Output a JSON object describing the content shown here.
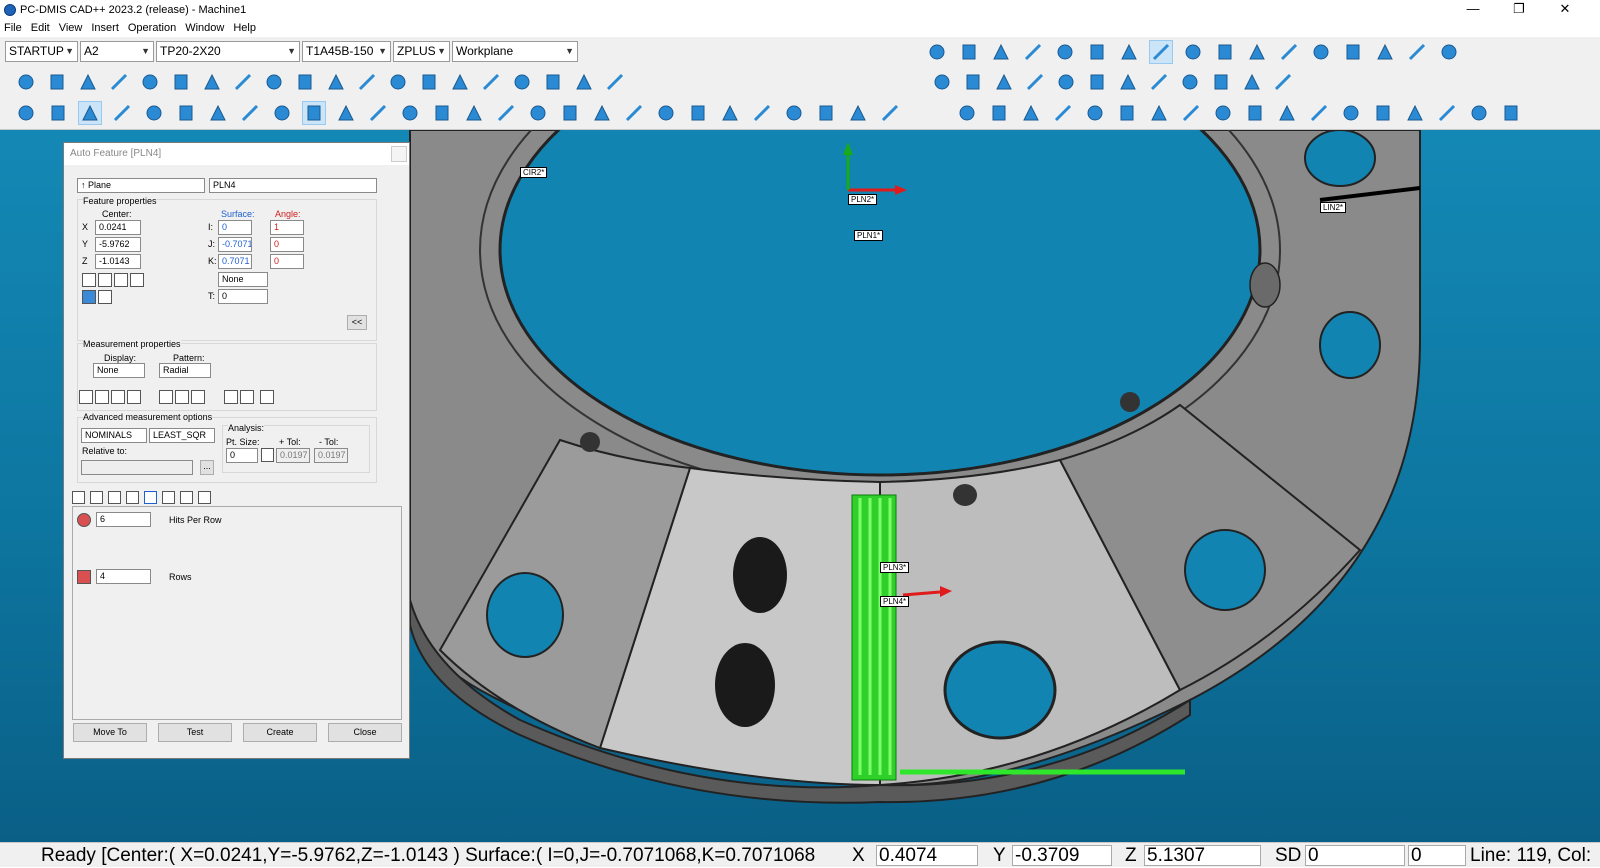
{
  "window": {
    "title": "PC-DMIS CAD++ 2023.2 (release) - Machine1",
    "minimize_glyph": "—",
    "restore_glyph": "❐",
    "close_glyph": "✕"
  },
  "menu": [
    "File",
    "Edit",
    "View",
    "Insert",
    "Operation",
    "Window",
    "Help"
  ],
  "toolbar": {
    "combos": [
      {
        "name": "alignment-combo",
        "value": "STARTUP"
      },
      {
        "name": "probe-combo",
        "value": "A2"
      },
      {
        "name": "probe-file-combo",
        "value": "TP20-2X20"
      },
      {
        "name": "tip-combo",
        "value": "T1A45B-150"
      },
      {
        "name": "view-combo",
        "value": "ZPLUS"
      },
      {
        "name": "workplane-combo",
        "value": "Workplane"
      }
    ]
  },
  "viewport": {
    "labels": {
      "cir2": "CIR2*",
      "pln2": "PLN2*",
      "pln1": "PLN1*",
      "lin2": "LIN2*",
      "pln3": "PLN3*",
      "pln4": "PLN4*"
    },
    "colors": {
      "background": "#1183b0",
      "part": "#7a7a7a",
      "hits": "#3ee62b",
      "vector": "#e01b1b"
    }
  },
  "dialog": {
    "title": "Auto Feature [PLN4]",
    "feature_type": "Plane",
    "feature_id": "PLN4",
    "feature_properties_label": "Feature properties",
    "center_label": "Center:",
    "surface_label": "Surface:",
    "angle_label": "Angle:",
    "x_label": "X",
    "y_label": "Y",
    "z_label": "Z",
    "i_label": "I:",
    "j_label": "J:",
    "k_label": "K:",
    "t_label": "T:",
    "x": "0.0241",
    "y": "-5.9762",
    "z": "-1.0143",
    "i": "0",
    "j": "-0.7071",
    "k": "0.7071",
    "angle_i": "1",
    "angle_j": "0",
    "angle_k": "0",
    "t": "0",
    "none_combo": "None",
    "collapse_button": "<<",
    "measurement_properties_label": "Measurement properties",
    "display_label": "Display:",
    "pattern_label": "Pattern:",
    "display_value": "None",
    "pattern_value": "Radial",
    "advanced_label": "Advanced measurement options",
    "nominals_value": "NOMINALS",
    "least_sqr_value": "LEAST_SQR",
    "relative_to_label": "Relative to:",
    "analysis_label": "Analysis:",
    "pt_size_label": "Pt. Size:",
    "plus_tol_label": "+ Tol:",
    "minus_tol_label": "- Tol:",
    "pt_size": "0",
    "plus_tol": "0.0197",
    "minus_tol": "0.0197",
    "hits_per_row": "6",
    "hits_per_row_label": "Hits Per Row",
    "rows": "4",
    "rows_label": "Rows",
    "buttons": {
      "move_to": "Move To",
      "test": "Test",
      "create": "Create",
      "close": "Close"
    },
    "ellipsis": "..."
  },
  "status": {
    "text": "Ready  [Center:( X=0.0241,Y=-5.9762,Z=-1.0143 )  Surface:( I=0,J=-0.7071068,K=0.7071068",
    "x_label": "X",
    "x_value": "0.4074",
    "y_label": "Y",
    "y_value": "-0.3709",
    "z_label": "Z",
    "z_value": "5.1307",
    "sd_label": "SD",
    "sd_value": "0",
    "extra_value": "0",
    "line": "Line: 119, Col:"
  }
}
